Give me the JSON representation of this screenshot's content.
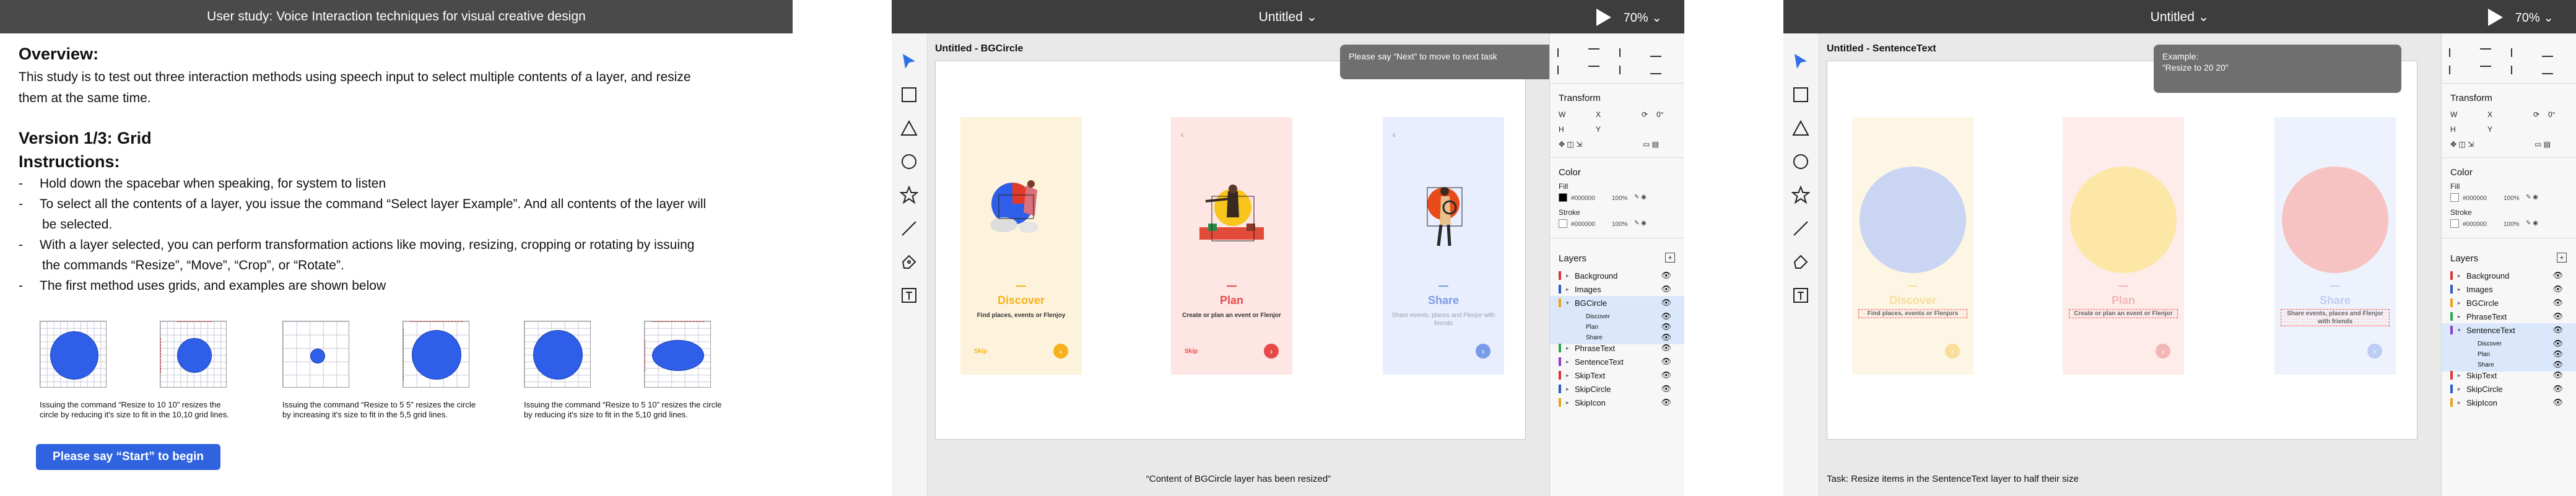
{
  "instructions": {
    "title_bar": "User study: Voice Interaction techniques for visual creative design",
    "overview_heading": "Overview:",
    "overview_text_line1": "This study is to test out three interaction methods using speech input to select multiple contents of a layer, and resize",
    "overview_text_line2": "them at the same time.",
    "version_heading": "Version 1/3: Grid",
    "instructions_heading": "Instructions:",
    "bullets": [
      "Hold down the spacebar when speaking, for system to listen",
      "To select all the contents of a layer, you issue the command “Select layer Example”. And all contents of the layer will",
      "be selected.",
      "With a layer selected, you can perform transformation actions like moving, resizing, cropping or rotating by issuing",
      "the commands “Resize”, “Move”, “Crop”, or “Rotate”.",
      "The first method uses grids, and examples are shown below"
    ],
    "captions": [
      "Issuing the command “Resize to 10 10” resizes the circle by reducing it's size to fit in the 10,10 grid lines.",
      "Issuing the command “Resize to 5 5” resizes the circle by increasing it's size to fit in the 5,5 grid lines.",
      "Issuing the command “Resize to 5 10” resizes the circle by reducing it's size to fit in the 5,10 grid lines."
    ],
    "start_button": "Please say “Start” to begin"
  },
  "editor1": {
    "title": "Untitled ⌄",
    "zoom": "70% ⌄",
    "frame_label": "Untitled - BGCircle",
    "tooltip": "Please say “Next” to move to next task",
    "status": "“Content of BGCircle layer has been resized”",
    "cards": [
      {
        "heading": "Discover",
        "sub": "Find places, events or Flenjoy",
        "skip": "Skip",
        "color": "#f7b11b",
        "bg": "#fdf3dc"
      },
      {
        "heading": "Plan",
        "sub": "Create or plan an event or Flenjor",
        "skip": "Skip",
        "color": "#e84a4a",
        "bg": "#fde6e4"
      },
      {
        "heading": "Share",
        "sub": "Share events, places and Flenjor with friends",
        "skip": "",
        "color": "#7a9ce8",
        "bg": "#e8eefd"
      }
    ]
  },
  "editor2": {
    "title": "Untitled ⌄",
    "zoom": "70% ⌄",
    "frame_label": "Untitled - SentenceText",
    "tooltip_line1": "Example:",
    "tooltip_line2": "“Resize to 20 20”",
    "status": "Task: Resize items in the SentenceText layer to half their size",
    "cards": [
      {
        "heading": "Discover",
        "sub": "Find places, events or Flenjors",
        "color": "#f7b11b",
        "bg": "#fdf3dc"
      },
      {
        "heading": "Plan",
        "sub": "Create or plan an event or Flenjor",
        "color": "#e84a4a",
        "bg": "#fde6e4"
      },
      {
        "heading": "Share",
        "sub": "Share events, places and Flenjor with friends",
        "color": "#7a9ce8",
        "bg": "#e8eefd"
      }
    ]
  },
  "props": {
    "transform": "Transform",
    "w": "W",
    "x": "X",
    "h": "H",
    "y": "Y",
    "rotation": "0°",
    "color": "Color",
    "fill": "Fill",
    "stroke": "Stroke",
    "fill_hex": "#000000",
    "fill_opacity": "100%",
    "stroke_hex": "#000000",
    "stroke_opacity": "100%",
    "layers": "Layers",
    "add_layer": "+"
  },
  "layers1": [
    {
      "name": "Background",
      "color": "#d33",
      "type": "layer"
    },
    {
      "name": "Images",
      "color": "#2b59c3",
      "type": "layer"
    },
    {
      "name": "BGCircle",
      "color": "#e8a21a",
      "type": "selected"
    },
    {
      "name": "Discover",
      "color": "",
      "type": "child"
    },
    {
      "name": "Plan",
      "color": "",
      "type": "child"
    },
    {
      "name": "Share",
      "color": "",
      "type": "child"
    },
    {
      "name": "PhraseText",
      "color": "#2aa84a",
      "type": "layer"
    },
    {
      "name": "SentenceText",
      "color": "#8a3fc7",
      "type": "layer"
    },
    {
      "name": "SkipText",
      "color": "#d33",
      "type": "layer"
    },
    {
      "name": "SkipCircle",
      "color": "#2b59c3",
      "type": "layer"
    },
    {
      "name": "SkipIcon",
      "color": "#e8a21a",
      "type": "layer"
    }
  ],
  "layers2": [
    {
      "name": "Background",
      "color": "#d33",
      "type": "layer"
    },
    {
      "name": "Images",
      "color": "#2b59c3",
      "type": "layer"
    },
    {
      "name": "BGCircle",
      "color": "#e8a21a",
      "type": "layer"
    },
    {
      "name": "PhraseText",
      "color": "#2aa84a",
      "type": "layer"
    },
    {
      "name": "SentenceText",
      "color": "#8a3fc7",
      "type": "selected"
    },
    {
      "name": "Discover",
      "color": "",
      "type": "child"
    },
    {
      "name": "Plan",
      "color": "",
      "type": "child"
    },
    {
      "name": "Share",
      "color": "",
      "type": "child"
    },
    {
      "name": "SkipText",
      "color": "#d33",
      "type": "layer"
    },
    {
      "name": "SkipCircle",
      "color": "#2b59c3",
      "type": "layer"
    },
    {
      "name": "SkipIcon",
      "color": "#e8a21a",
      "type": "layer"
    }
  ],
  "grid_numbers": [
    "5",
    "10",
    "10",
    "10",
    "10"
  ]
}
